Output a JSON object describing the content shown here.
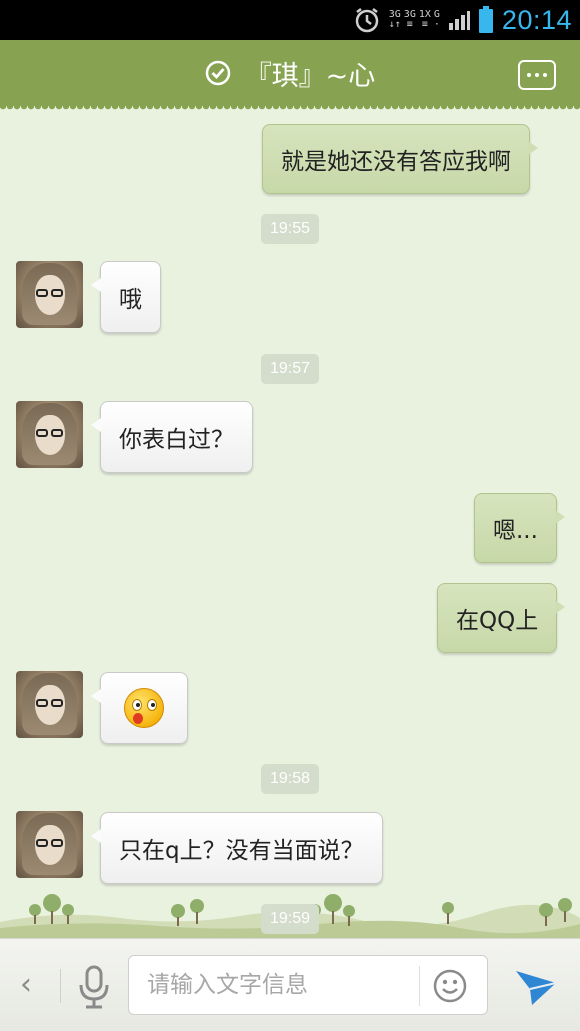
{
  "status_bar": {
    "time": "20:14",
    "network_1": "3G",
    "network_2": "3G",
    "network_3": "1X",
    "network_4": "G"
  },
  "header": {
    "title": "『琪』~心"
  },
  "messages": [
    {
      "type": "out",
      "text": "就是她还没有答应我啊"
    },
    {
      "type": "time",
      "text": "19:55"
    },
    {
      "type": "in",
      "text": "哦"
    },
    {
      "type": "time",
      "text": "19:57"
    },
    {
      "type": "in",
      "text": "你表白过？"
    },
    {
      "type": "out",
      "text": "嗯..."
    },
    {
      "type": "out",
      "text": "在QQ上"
    },
    {
      "type": "in",
      "emoji": "surprised-face"
    },
    {
      "type": "time",
      "text": "19:58"
    },
    {
      "type": "in",
      "text": "只在q上？没有当面说？"
    },
    {
      "type": "time",
      "text": "19:59"
    }
  ],
  "input": {
    "placeholder": "请输入文字信息",
    "value": ""
  },
  "colors": {
    "header_bg": "#87a352",
    "chat_bg": "#e9f1df",
    "outgoing_bubble": "#cfdeb3",
    "incoming_bubble": "#ffffff",
    "send_icon": "#2f86d3",
    "clock": "#38b7ee"
  },
  "icons": [
    "alarm-icon",
    "signal-icon",
    "battery-icon",
    "verified-check-icon",
    "more-menu-icon",
    "back-chevron-icon",
    "microphone-icon",
    "smiley-icon",
    "send-icon"
  ]
}
